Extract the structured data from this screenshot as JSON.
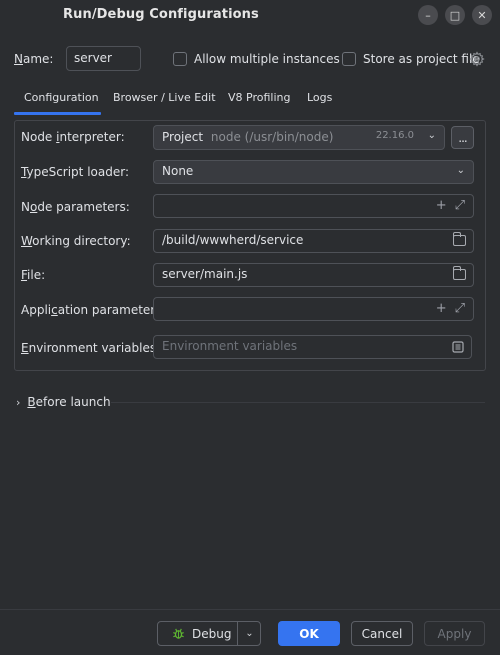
{
  "window": {
    "title": "Run/Debug Configurations",
    "min_glyph": "–",
    "max_glyph": "□",
    "close_glyph": "✕"
  },
  "header": {
    "name_label_pre": "",
    "name_label_u": "N",
    "name_label_post": "ame:",
    "name_value": "server",
    "allow_multiple_label": "Allow multiple instances",
    "store_project_label": "Store as project file"
  },
  "tabs": [
    {
      "label": "Configuration",
      "active": true
    },
    {
      "label": "Browser / Live Edit",
      "active": false
    },
    {
      "label": "V8 Profiling",
      "active": false
    },
    {
      "label": "Logs",
      "active": false
    }
  ],
  "form": {
    "node_interpreter": {
      "label_pre": "Node ",
      "label_u": "i",
      "label_post": "nterpreter:",
      "value_main": "Project",
      "value_suffix": "node (/usr/bin/node)",
      "version": "22.16.0",
      "more_label": "..."
    },
    "typescript_loader": {
      "label_pre": "",
      "label_u": "T",
      "label_post": "ypeScript loader:",
      "value": "None"
    },
    "node_parameters": {
      "label_pre": "N",
      "label_u": "o",
      "label_post": "de parameters:",
      "value": ""
    },
    "working_directory": {
      "label_pre": "",
      "label_u": "W",
      "label_post": "orking directory:",
      "value": "/build/wwwherd/service"
    },
    "file": {
      "label_pre": "",
      "label_u": "F",
      "label_post": "ile:",
      "value": "server/main.js"
    },
    "app_parameters": {
      "label_pre": "Appli",
      "label_u": "c",
      "label_post": "ation parameters:",
      "value": ""
    },
    "env_variables": {
      "label_pre": "",
      "label_u": "E",
      "label_post": "nvironment variables:",
      "placeholder": "Environment variables"
    }
  },
  "before_launch": {
    "label_pre": "",
    "label_u": "B",
    "label_post": "efore launch"
  },
  "footer": {
    "debug_label": "Debug",
    "ok_label": "OK",
    "cancel_label": "Cancel",
    "apply_label": "Apply"
  },
  "colors": {
    "accent": "#3574f0",
    "background": "#2b2d30",
    "field_fill": "#393b40"
  }
}
